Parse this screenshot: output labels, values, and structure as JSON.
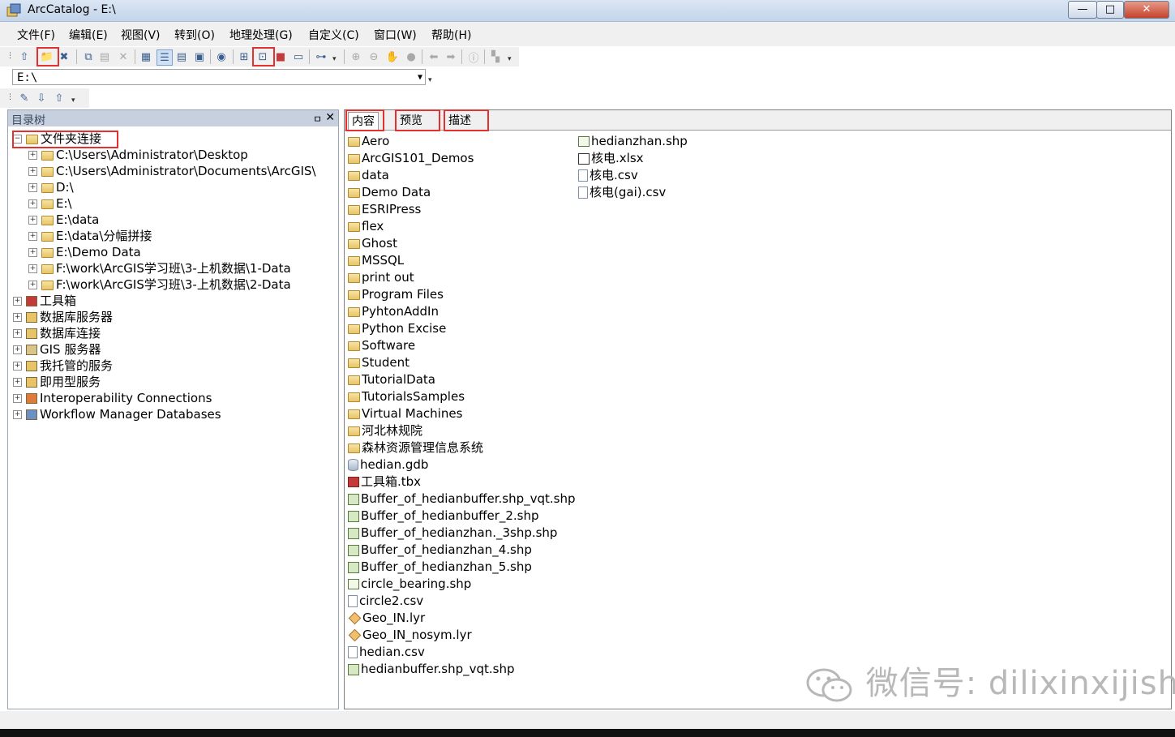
{
  "window": {
    "title": "ArcCatalog - E:\\",
    "controls": {
      "minimize": "—",
      "maximize": "□",
      "close": "✕"
    }
  },
  "menu": [
    "文件(F)",
    "编辑(E)",
    "视图(V)",
    "转到(O)",
    "地理处理(G)",
    "自定义(C)",
    "窗口(W)",
    "帮助(H)"
  ],
  "address": {
    "value": "E:\\"
  },
  "catalog_tree": {
    "title": "目录树",
    "pin": "ㅁ",
    "close": "✕",
    "root": "文件夹连接",
    "folder_connections": [
      "C:\\Users\\Administrator\\Desktop",
      "C:\\Users\\Administrator\\Documents\\ArcGIS\\",
      "D:\\",
      "E:\\",
      "E:\\data",
      "E:\\data\\分幅拼接",
      "E:\\Demo Data",
      "F:\\work\\ArcGIS学习班\\3-上机数据\\1-Data",
      "F:\\work\\ArcGIS学习班\\3-上机数据\\2-Data"
    ],
    "other_nodes": [
      {
        "label": "工具箱",
        "icon": "toolbox-icon"
      },
      {
        "label": "数据库服务器",
        "icon": "database-server-icon"
      },
      {
        "label": "数据库连接",
        "icon": "database-connection-icon"
      },
      {
        "label": "GIS 服务器",
        "icon": "gis-server-icon"
      },
      {
        "label": "我托管的服务",
        "icon": "hosted-services-icon"
      },
      {
        "label": "即用型服务",
        "icon": "ready-services-icon"
      },
      {
        "label": "Interoperability Connections",
        "icon": "interop-icon"
      },
      {
        "label": "Workflow Manager Databases",
        "icon": "workflow-db-icon"
      }
    ]
  },
  "tabs": [
    "内容",
    "预览",
    "描述"
  ],
  "contents": {
    "column1": [
      {
        "name": "Aero",
        "type": "folder"
      },
      {
        "name": "ArcGIS101_Demos",
        "type": "folder"
      },
      {
        "name": "data",
        "type": "folder"
      },
      {
        "name": "Demo Data",
        "type": "folder"
      },
      {
        "name": "ESRIPress",
        "type": "folder"
      },
      {
        "name": "flex",
        "type": "folder"
      },
      {
        "name": "Ghost",
        "type": "folder"
      },
      {
        "name": "MSSQL",
        "type": "folder"
      },
      {
        "name": "print out",
        "type": "folder"
      },
      {
        "name": "Program Files",
        "type": "folder"
      },
      {
        "name": "PyhtonAddIn",
        "type": "folder"
      },
      {
        "name": "Python Excise",
        "type": "folder"
      },
      {
        "name": "Software",
        "type": "folder"
      },
      {
        "name": "Student",
        "type": "folder"
      },
      {
        "name": "TutorialData",
        "type": "folder"
      },
      {
        "name": "TutorialsSamples",
        "type": "folder"
      },
      {
        "name": "Virtual Machines",
        "type": "folder"
      },
      {
        "name": "河北林规院",
        "type": "folder"
      },
      {
        "name": "森林资源管理信息系统",
        "type": "folder"
      },
      {
        "name": "hedian.gdb",
        "type": "gdb"
      },
      {
        "name": "工具箱.tbx",
        "type": "tbx"
      },
      {
        "name": "Buffer_of_hedianbuffer.shp_vqt.shp",
        "type": "shp"
      },
      {
        "name": "Buffer_of_hedianbuffer_2.shp",
        "type": "shp"
      },
      {
        "name": "Buffer_of_hedianzhan._3shp.shp",
        "type": "shp"
      },
      {
        "name": "Buffer_of_hedianzhan_4.shp",
        "type": "shp"
      },
      {
        "name": "Buffer_of_hedianzhan_5.shp",
        "type": "shp"
      },
      {
        "name": "circle_bearing.shp",
        "type": "line"
      },
      {
        "name": "circle2.csv",
        "type": "csv"
      },
      {
        "name": "Geo_IN.lyr",
        "type": "lyr"
      },
      {
        "name": "Geo_IN_nosym.lyr",
        "type": "lyr"
      },
      {
        "name": "hedian.csv",
        "type": "csv"
      },
      {
        "name": "hedianbuffer.shp_vqt.shp",
        "type": "shp"
      }
    ],
    "column2": [
      {
        "name": "hedianzhan.shp",
        "type": "point"
      },
      {
        "name": "核电.xlsx",
        "type": "xlsx"
      },
      {
        "name": "核电.csv",
        "type": "csv"
      },
      {
        "name": "核电(gai).csv",
        "type": "csv"
      }
    ]
  },
  "watermark": {
    "text": "微信号: dilixinxijishu"
  },
  "colors": {
    "highlight_box": "#e53030",
    "panel_header": "#c6d0de",
    "folder": "#e8c466"
  }
}
